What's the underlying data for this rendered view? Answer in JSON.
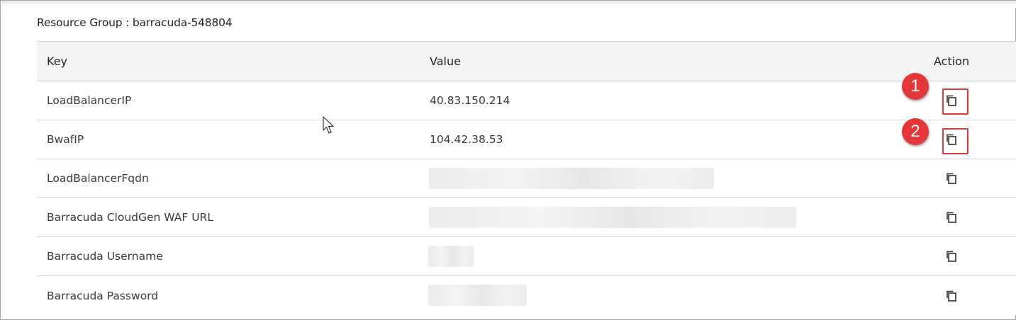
{
  "resource_group": {
    "title": "Resource Group : barracuda-548804"
  },
  "table": {
    "headers": {
      "key": "Key",
      "value": "Value",
      "action": "Action"
    },
    "rows": [
      {
        "key": "LoadBalancerIP",
        "value": "40.83.150.214"
      },
      {
        "key": "BwafIP",
        "value": "104.42.38.53"
      },
      {
        "key": "LoadBalancerFqdn",
        "value": ""
      },
      {
        "key": "Barracuda CloudGen WAF URL",
        "value": ""
      },
      {
        "key": "Barracuda Username",
        "value": ""
      },
      {
        "key": "Barracuda Password",
        "value": ""
      }
    ]
  },
  "annotations": {
    "step1": "1",
    "step2": "2"
  },
  "icons": {
    "copy": "copy-icon",
    "cursor": "mouse-pointer-icon"
  },
  "colors": {
    "highlight": "#e5363a",
    "header_bg": "#f3f3f3"
  }
}
